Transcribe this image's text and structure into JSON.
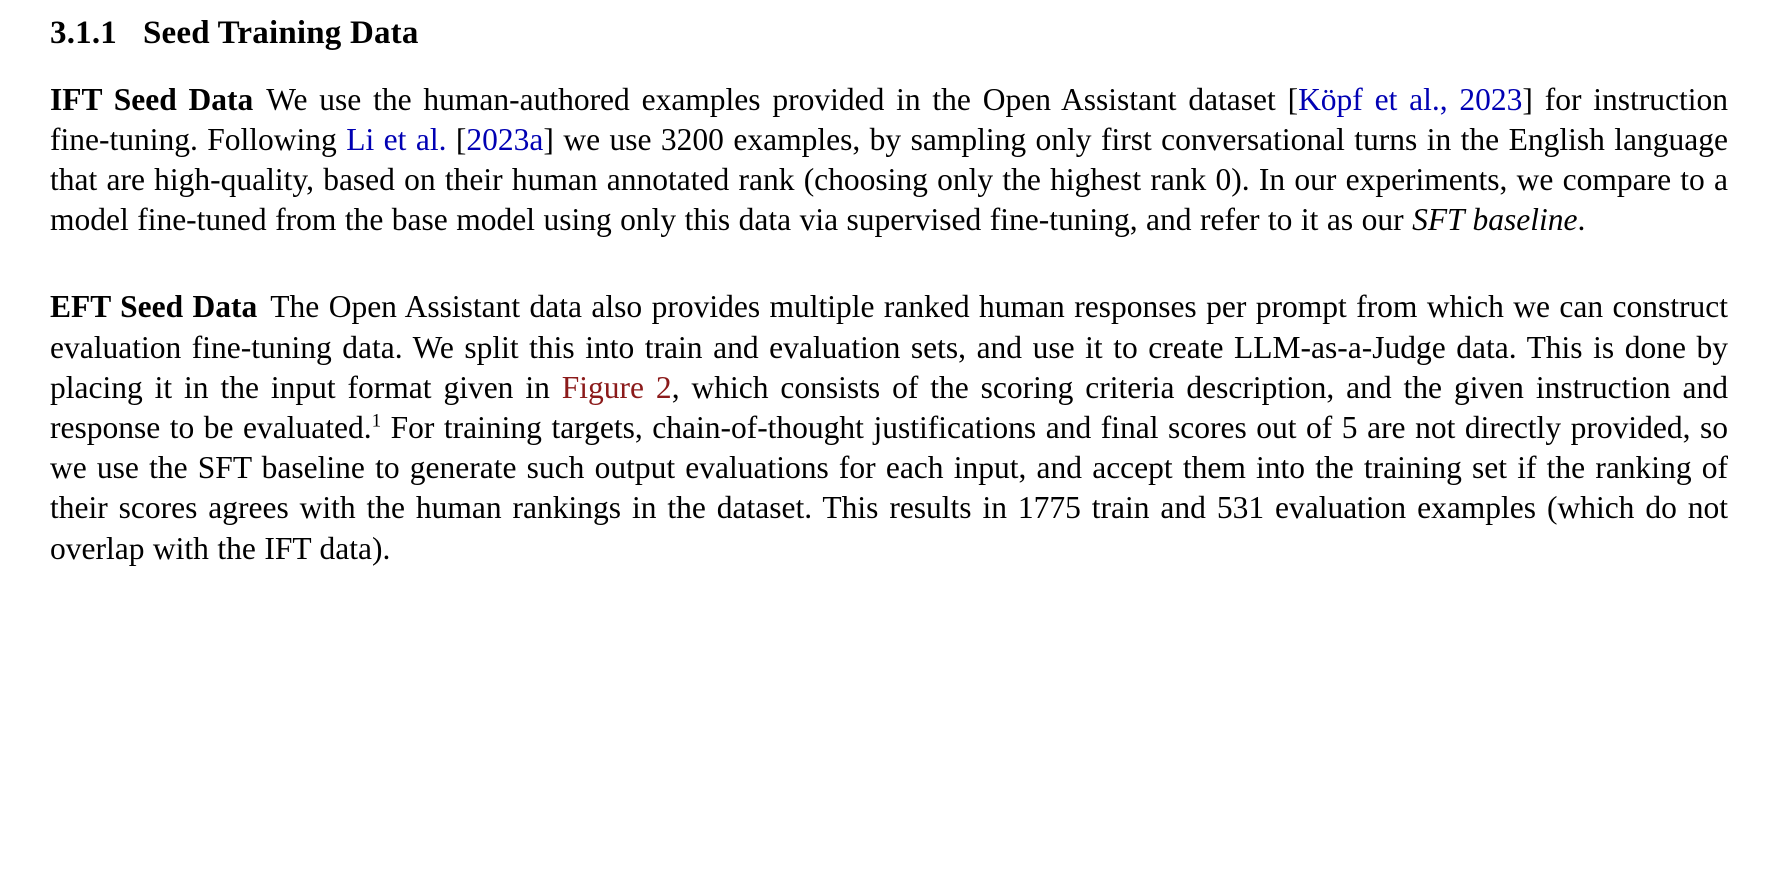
{
  "document": {
    "heading": {
      "number": "3.1.1",
      "title": "Seed Training Data"
    },
    "paragraphs": [
      {
        "run_in": "IFT Seed Data",
        "segments": [
          {
            "type": "text",
            "value": "We use the human-authored examples provided in the Open Assistant dataset ["
          },
          {
            "type": "cite",
            "value": "Köpf et al., 2023"
          },
          {
            "type": "text",
            "value": "] for instruction fine-tuning.  Following "
          },
          {
            "type": "cite",
            "value": "Li et al."
          },
          {
            "type": "text",
            "value": " ["
          },
          {
            "type": "cite",
            "value": "2023a"
          },
          {
            "type": "text",
            "value": "] we use 3200 examples, by sampling only first conversational turns in the English language that are high-quality, based on their human annotated rank (choosing only the highest rank 0).  In our experiments, we compare to a model fine-tuned from the base model using only this data via supervised fine-tuning, and refer to it as our "
          },
          {
            "type": "italic",
            "value": "SFT baseline"
          },
          {
            "type": "text",
            "value": "."
          }
        ]
      },
      {
        "run_in": "EFT Seed Data",
        "segments": [
          {
            "type": "text",
            "value": "The Open Assistant data also provides multiple ranked human responses per prompt from which we can construct evaluation fine-tuning data.  We split this into train and evaluation sets, and use it to create LLM-as-a-Judge data.  This is done by placing it in the input format given in "
          },
          {
            "type": "reflink",
            "value": "Figure 2"
          },
          {
            "type": "text",
            "value": ", which consists of the scoring criteria description, and the given instruction and response to be evaluated."
          },
          {
            "type": "footnote",
            "value": "1"
          },
          {
            "type": "text",
            "value": " For training targets, chain-of-thought justifications and final scores out of 5 are not directly provided, so we use the SFT baseline to generate such output evaluations for each input, and accept them into the training set if the ranking of their scores agrees with the human rankings in the dataset.  This results in 1775 train and 531 evaluation examples (which do not overlap with the IFT data)."
          }
        ]
      }
    ],
    "colors": {
      "citation_link": "#0000b3",
      "figure_reference_link": "#8b1a1a",
      "body_text": "#000000"
    }
  }
}
